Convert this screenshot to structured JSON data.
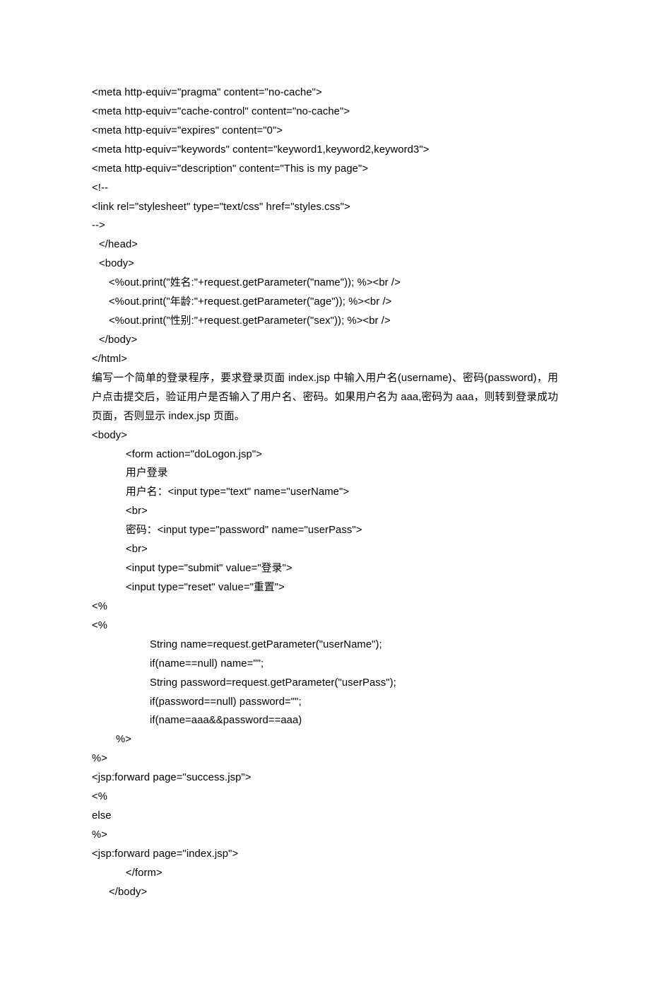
{
  "lines": {
    "l1": "<meta http-equiv=\"pragma\" content=\"no-cache\">",
    "l2": "<meta http-equiv=\"cache-control\" content=\"no-cache\">",
    "l3": "<meta http-equiv=\"expires\" content=\"0\">",
    "l4": "<meta http-equiv=\"keywords\" content=\"keyword1,keyword2,keyword3\">",
    "l5": "<meta http-equiv=\"description\" content=\"This is my page\">",
    "l6": "<!--",
    "l7": "<link rel=\"stylesheet\" type=\"text/css\" href=\"styles.css\">",
    "l8": "-->",
    "l9": "</head>",
    "l10": "<body>",
    "l11": "<%out.print(\"姓名:\"+request.getParameter(\"name\")); %><br />",
    "l12": "<%out.print(\"年龄:\"+request.getParameter(\"age\")); %><br />",
    "l13": "<%out.print(\"性别:\"+request.getParameter(\"sex\")); %><br />",
    "l14": "</body>",
    "l15": "</html>",
    "p1": "编写一个简单的登录程序，要求登录页面 index.jsp 中输入用户名(username)、密码(password)，用户点击提交后，验证用户是否输入了用户名、密码。如果用户名为 aaa,密码为 aaa，则转到登录成功页面，否则显示 index.jsp 页面。",
    "l16": "<body>",
    "l17": "<form action=\"doLogon.jsp\">",
    "l18": "用户登录",
    "l19": "用户名：<input type=\"text\" name=\"userName\">",
    "l20": "<br>",
    "l21": "密码：<input type=\"password\" name=\"userPass\">",
    "l22": "<br>",
    "l23": "<input type=\"submit\" value=\"登录\">",
    "l24": "<input type=\"reset\" value=\"重置\">",
    "l25": "<%",
    "l26": "<%",
    "l27": "String name=request.getParameter(\"userName\");",
    "l28": "if(name==null) name=\"\";",
    "l29": "String password=request.getParameter(\"userPass\");",
    "l30": "if(password==null) password=\"\";",
    "l31": "if(name=aaa&&password==aaa)",
    "l32": "%>",
    "l33": "%>",
    "l34": "<jsp:forward page=\"success.jsp\">",
    "l35": "<%",
    "l36": "else",
    "l37": "%>",
    "l38": "<jsp:forward page=\"index.jsp\">",
    "l39": "</form>",
    "l40": "</body>"
  }
}
